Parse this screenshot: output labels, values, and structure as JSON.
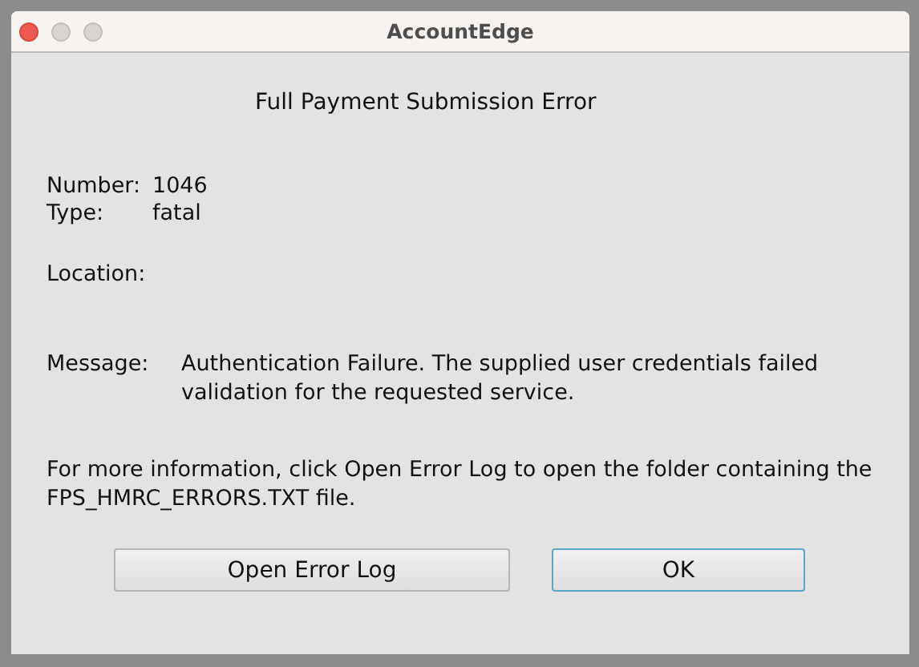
{
  "window": {
    "title": "AccountEdge"
  },
  "heading": "Full Payment Submission Error",
  "fields": [
    {
      "label": "Number:",
      "value": "1046"
    },
    {
      "label": "Type:",
      "value": "fatal"
    },
    {
      "label": "Location:"
    }
  ],
  "message": {
    "label": "Message:",
    "value": "Authentication Failure. The supplied user credentials failed validation for the requested service."
  },
  "info": "For more information, click Open Error Log to open the folder containing the FPS_HMRC_ERRORS.TXT file.",
  "buttons": [
    {
      "label": "Open Error Log",
      "focused": false
    },
    {
      "label": "OK",
      "focused": true
    }
  ]
}
